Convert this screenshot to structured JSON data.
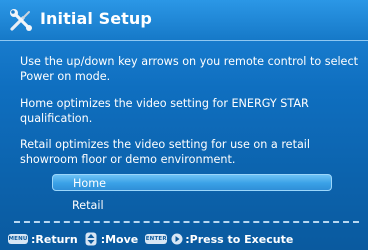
{
  "title": "Initial Setup",
  "paragraphs": {
    "p1": "Use the up/down key arrows on you remote control to select Power on mode.",
    "p2": "Home optimizes the video setting for ENERGY STAR qualification.",
    "p3": "Retail optimizes the video setting for use on a retail showroom floor or demo environment."
  },
  "options": [
    {
      "label": "Home",
      "selected": true
    },
    {
      "label": "Retail",
      "selected": false
    }
  ],
  "footer": {
    "menu_key": "MENU",
    "return_label": ":Return",
    "updown_icon": "up-down-arrows-icon",
    "move_label": ":Move",
    "enter_key": "ENTER",
    "right_icon": "right-arrow-icon",
    "execute_label": ":Press to Execute"
  },
  "colors": {
    "background": "#0f6fc0",
    "highlight": "#3aa1e6",
    "text": "#ffffff"
  }
}
